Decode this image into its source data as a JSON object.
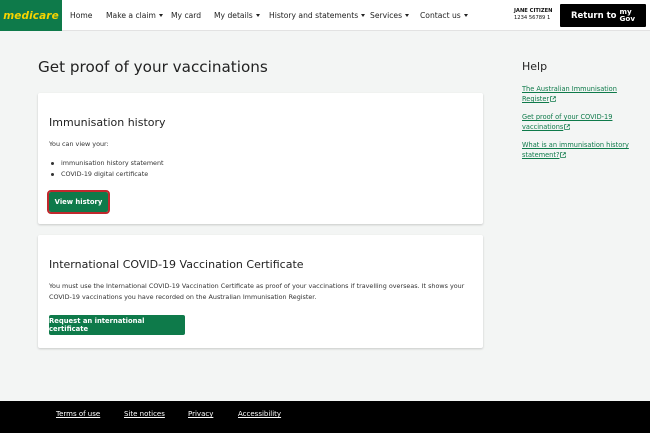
{
  "header": {
    "logo_text": "medicare",
    "nav": [
      {
        "label": "Home",
        "dropdown": false
      },
      {
        "label": "Make a claim",
        "dropdown": true
      },
      {
        "label": "My card",
        "dropdown": false
      },
      {
        "label": "My details",
        "dropdown": true
      },
      {
        "label": "History and statements",
        "dropdown": true
      },
      {
        "label": "Services",
        "dropdown": true
      },
      {
        "label": "Contact us",
        "dropdown": true
      }
    ],
    "user_name": "JANE CITIZEN",
    "user_id": "1234 56789 1",
    "mygov_button": {
      "prefix": "Return to",
      "brand_top": "my",
      "brand_bottom": "Gov"
    }
  },
  "main": {
    "page_title": "Get proof of your vaccinations",
    "cards": [
      {
        "title": "Immunisation history",
        "text": "You can view your:",
        "bullets": [
          "immunisation history statement",
          "COVID-19 digital certificate"
        ],
        "button": "View history"
      },
      {
        "title": "International COVID-19 Vaccination Certificate",
        "text": "You must use the International COVID-19 Vaccination Certificate as proof of your vaccinations if travelling overseas. It shows your COVID-19 vaccinations you have recorded on the Australian Immunisation Register.",
        "button": "Request an international certificate"
      }
    ]
  },
  "help": {
    "title": "Help",
    "links": [
      "The Australian Immunisation Register",
      "Get proof of your COVID-19 vaccinations",
      "What is an immunisation history statement?"
    ]
  },
  "footer": {
    "links": [
      "Terms of use",
      "Site notices",
      "Privacy",
      "Accessibility"
    ]
  },
  "colors": {
    "brand_green": "#0e7a4a",
    "logo_yellow": "#f6d400",
    "focus_red": "#c0282d",
    "footer_bg": "#000000"
  }
}
